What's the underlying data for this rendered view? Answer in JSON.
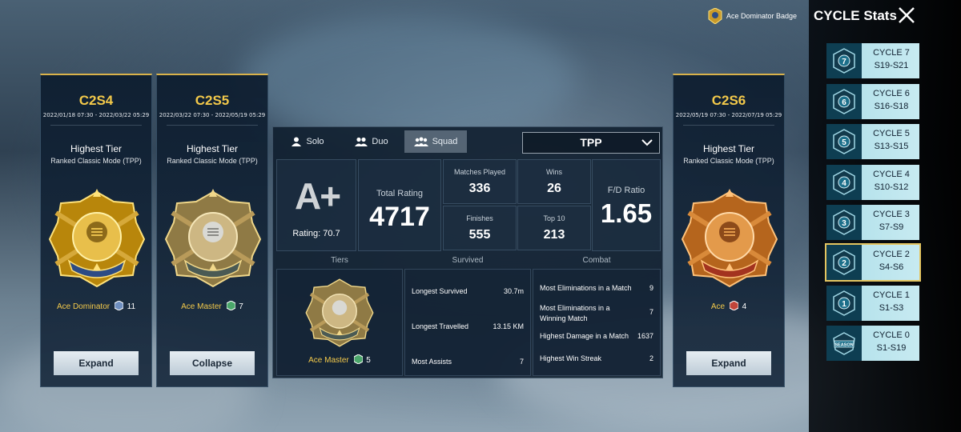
{
  "header": {
    "badge_link": "Ace Dominator Badge",
    "title": "CYCLE Stats"
  },
  "seasons": [
    {
      "code": "C2S4",
      "dates": "2022/01/18 07:30 - 2022/03/22 05:29",
      "tier_heading": "Highest Tier",
      "mode": "Ranked Classic Mode (TPP)",
      "tier_name": "Ace Dominator",
      "tier_level": "11",
      "button": "Expand"
    },
    {
      "code": "C2S5",
      "dates": "2022/03/22 07:30 - 2022/05/19 05:29",
      "tier_heading": "Highest Tier",
      "mode": "Ranked Classic Mode (TPP)",
      "tier_name": "Ace Master",
      "tier_level": "7",
      "button": "Collapse"
    },
    {
      "code": "C2S6",
      "dates": "2022/05/19 07:30 - 2022/07/19 05:29",
      "tier_heading": "Highest Tier",
      "mode": "Ranked Classic Mode (TPP)",
      "tier_name": "Ace",
      "tier_level": "4",
      "button": "Expand"
    }
  ],
  "center": {
    "tabs": [
      "Solo",
      "Duo",
      "Squad"
    ],
    "active_tab": "Squad",
    "perspective": "TPP",
    "grade": "A+",
    "rating_text": "Rating: 70.7",
    "total_rating_label": "Total Rating",
    "total_rating": "4717",
    "matches_played_label": "Matches Played",
    "matches_played": "336",
    "wins_label": "Wins",
    "wins": "26",
    "finishes_label": "Finishes",
    "finishes": "555",
    "top10_label": "Top 10",
    "top10": "213",
    "fd_label": "F/D Ratio",
    "fd_ratio": "1.65",
    "col_tiers": "Tiers",
    "col_survived": "Survived",
    "col_combat": "Combat",
    "tier_name": "Ace Master",
    "tier_level": "5",
    "survived": [
      {
        "label": "Longest Survived",
        "value": "30.7m"
      },
      {
        "label": "Longest Travelled",
        "value": "13.15 KM"
      },
      {
        "label": "Most Assists",
        "value": "7"
      }
    ],
    "combat": [
      {
        "label": "Most Eliminations in a Match",
        "value": "9"
      },
      {
        "label": "Most Eliminations in a Winning Match",
        "value": "7"
      },
      {
        "label": "Highest Damage in a Match",
        "value": "1637"
      },
      {
        "label": "Highest Win Streak",
        "value": "2"
      }
    ]
  },
  "cycles": [
    {
      "number": "7",
      "name": "CYCLE 7",
      "range": "S19-S21"
    },
    {
      "number": "6",
      "name": "CYCLE 6",
      "range": "S16-S18"
    },
    {
      "number": "5",
      "name": "CYCLE 5",
      "range": "S13-S15"
    },
    {
      "number": "4",
      "name": "CYCLE 4",
      "range": "S10-S12"
    },
    {
      "number": "3",
      "name": "CYCLE 3",
      "range": "S7-S9"
    },
    {
      "number": "2",
      "name": "CYCLE 2",
      "range": "S4-S6",
      "selected": true
    },
    {
      "number": "1",
      "name": "CYCLE 1",
      "range": "S1-S3"
    },
    {
      "number": "SEASON",
      "name": "CYCLE 0",
      "range": "S1-S19"
    }
  ],
  "colors": {
    "gold": "#f3c94a",
    "cycle_badge": "#0e3e52",
    "cycle_tile": "#c7eaf1",
    "selected_outline": "#e4c560"
  }
}
